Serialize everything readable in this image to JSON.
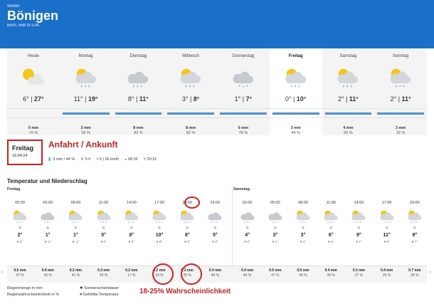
{
  "header": {
    "label": "Wetter",
    "city": "Bönigen",
    "sub": "Bern, 568 m ü.M."
  },
  "colors": {
    "header_bg": "#1a6fc9",
    "annotation": "#d62020",
    "rain": "#4d8fd6"
  },
  "days": [
    {
      "name": "Heute",
      "icon": "sun-cloud-icon",
      "min": "6°",
      "max": "27°",
      "rain": "0 mm",
      "prob": "<5 %"
    },
    {
      "name": "Montag",
      "icon": "sun-cloud-rain-icon",
      "min": "11°",
      "max": "19°",
      "rain": "3 mm",
      "prob": "59 %"
    },
    {
      "name": "Dienstag",
      "icon": "cloud-rain-icon",
      "min": "8°",
      "max": "11°",
      "rain": "8 mm",
      "prob": "83 %"
    },
    {
      "name": "Mittwoch",
      "icon": "sun-cloud-rain-icon",
      "min": "3°",
      "max": "8°",
      "rain": "8 mm",
      "prob": "82 %"
    },
    {
      "name": "Donnerstag",
      "icon": "cloud-snow-icon",
      "min": "1°",
      "max": "7°",
      "rain": "6 mm",
      "prob": "78 %"
    },
    {
      "name": "Freitag",
      "icon": "sun-cloud-rain-icon",
      "min": "0°",
      "max": "10°",
      "rain": "3 mm",
      "prob": "44 %"
    },
    {
      "name": "Samstag",
      "icon": "sun-cloud-rain-icon",
      "min": "2°",
      "max": "11°",
      "rain": "4 mm",
      "prob": "56 %"
    },
    {
      "name": "Sonntag",
      "icon": "sun-cloud-rain-icon",
      "min": "2°",
      "max": "11°",
      "rain": "3 mm",
      "prob": "32 %"
    }
  ],
  "selected": {
    "day": "Freitag",
    "date": "19.04.24",
    "annotation": "Anfahrt / Ankunft",
    "rain": "3 mm / 44 %",
    "sun": "5 h",
    "wind": "6 | 26 km/h",
    "sunrise": "06:32",
    "sunset": "20:21"
  },
  "section_title": "Temperatur und Niederschlag",
  "day_labels": {
    "first": "Freitag",
    "second": "Samstag"
  },
  "hours": [
    {
      "time": "02:00",
      "icon": "sun-cloud-rain-icon",
      "temp": "2°",
      "feel": "0°",
      "rain": "0.5 mm",
      "prob": "47 %"
    },
    {
      "time": "05:00",
      "icon": "cloud-rain-icon",
      "temp": "1°",
      "feel": "-1°",
      "rain": "0.4 mm",
      "prob": "43 %"
    },
    {
      "time": "08:00",
      "icon": "sun-cloud-rain-icon",
      "temp": "1°",
      "feel": "-1°",
      "rain": "0.3 mm",
      "prob": "41 %"
    },
    {
      "time": "11:00",
      "icon": "sun-cloud-rain-icon",
      "temp": "5°",
      "feel": "3°",
      "rain": "0.3 mm",
      "prob": "29 %"
    },
    {
      "time": "14:00",
      "icon": "sun-cloud-rain-icon",
      "temp": "8°",
      "feel": "6°",
      "rain": "0.2 mm",
      "prob": "17 %"
    },
    {
      "time": "17:00",
      "icon": "sun-cloud-rain-icon",
      "temp": "10°",
      "feel": "8°",
      "rain": "0.2 mm",
      "prob": "18 %"
    },
    {
      "time": "20:00",
      "icon": "sun-cloud-rain-icon",
      "temp": "8°",
      "feel": "6°",
      "rain": "0.3 mm",
      "prob": "25 %"
    },
    {
      "time": "23:00",
      "icon": "cloud-rain-icon",
      "temp": "5°",
      "feel": "3°",
      "rain": "0.4 mm",
      "prob": "40 %"
    },
    {
      "time": "02:00",
      "icon": "cloud-rain-icon",
      "temp": "4°",
      "feel": "2°",
      "rain": "0.4 mm",
      "prob": "44 %"
    },
    {
      "time": "05:00",
      "icon": "cloud-rain-icon",
      "temp": "3°",
      "feel": "1°",
      "rain": "0.5 mm",
      "prob": "47 %"
    },
    {
      "time": "08:00",
      "icon": "sun-cloud-rain-icon",
      "temp": "3°",
      "feel": "1°",
      "rain": "0.5 mm",
      "prob": "45 %"
    },
    {
      "time": "11:00",
      "icon": "sun-cloud-rain-icon",
      "temp": "6°",
      "feel": "4°",
      "rain": "0.4 mm",
      "prob": "39 %"
    },
    {
      "time": "14:00",
      "icon": "sun-cloud-rain-icon",
      "temp": "9°",
      "feel": "7°",
      "rain": "0.3 mm",
      "prob": "27 %"
    },
    {
      "time": "17:00",
      "icon": "sun-cloud-rain-icon",
      "temp": "11°",
      "feel": "9°",
      "rain": "0.4 mm",
      "prob": "20 %"
    },
    {
      "time": "20:00",
      "icon": "sun-cloud-rain-icon",
      "temp": "9°",
      "feel": "7°",
      "rain": "0.7 mm",
      "prob": "28 %"
    }
  ],
  "legend": {
    "l1": "Regenmenge in mm",
    "l2": "Regenwahrscheinlichkeit in %",
    "l3": "Sonnenscheindauer",
    "l4": "Gefühlte Temperatur"
  },
  "annotation_bottom": "18-25% Wahrscheinlichkeit",
  "edge_left": "0",
  "edge_right": "0"
}
